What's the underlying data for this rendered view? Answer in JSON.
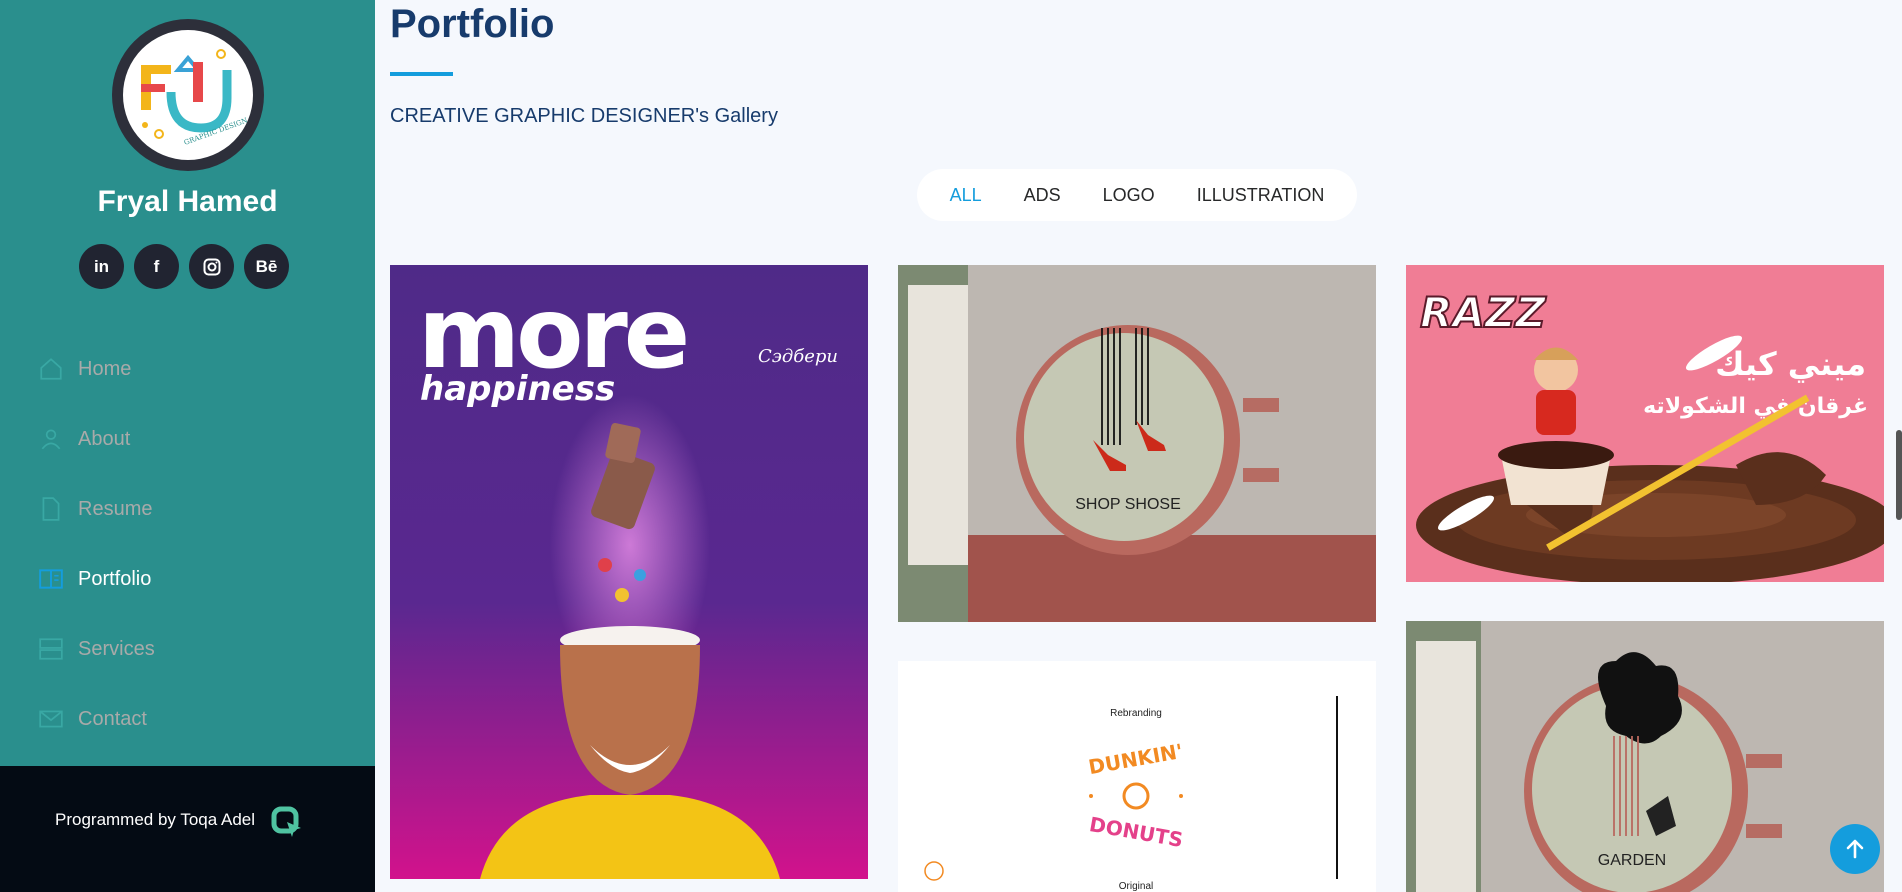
{
  "profile": {
    "name": "Fryal Hamed",
    "logo_text": "GRAPHIC DESIGN"
  },
  "social": [
    {
      "label": "in",
      "icon": "linkedin-icon"
    },
    {
      "label": "f",
      "icon": "facebook-icon"
    },
    {
      "label": "",
      "icon": "instagram-icon"
    },
    {
      "label": "Bē",
      "icon": "behance-icon"
    }
  ],
  "nav": [
    {
      "label": "Home",
      "icon": "home-icon"
    },
    {
      "label": "About",
      "icon": "person-icon"
    },
    {
      "label": "Resume",
      "icon": "file-icon"
    },
    {
      "label": "Portfolio",
      "icon": "book-icon",
      "active": true
    },
    {
      "label": "Services",
      "icon": "server-icon"
    },
    {
      "label": "Contact",
      "icon": "envelope-icon"
    }
  ],
  "footer": {
    "text": "Programmed by Toqa Adel"
  },
  "section": {
    "title": "Portfolio",
    "subtitle": "CREATIVE GRAPHIC DESIGNER's Gallery"
  },
  "filters": [
    "ALL",
    "ADS",
    "LOGO",
    "ILLUSTRATION"
  ],
  "tiles": {
    "ad1": {
      "headline": "more",
      "sub": "happiness",
      "brand": "Сэдбери"
    },
    "shop": {
      "label": "SHOP SHOSE"
    },
    "razz": {
      "brand": "RAZZ",
      "line1": "ميني كيك",
      "line2": "غرقان في الشكولاته"
    },
    "dunkin": {
      "top": "Rebranding",
      "word1": "DUNKIN'",
      "word2": "DONUTS",
      "bottom": "Original"
    },
    "garden": {
      "label": "GARDEN"
    }
  },
  "colors": {
    "sidebar": "#2a8f8d",
    "accent": "#149ddd",
    "title": "#173b6c"
  }
}
